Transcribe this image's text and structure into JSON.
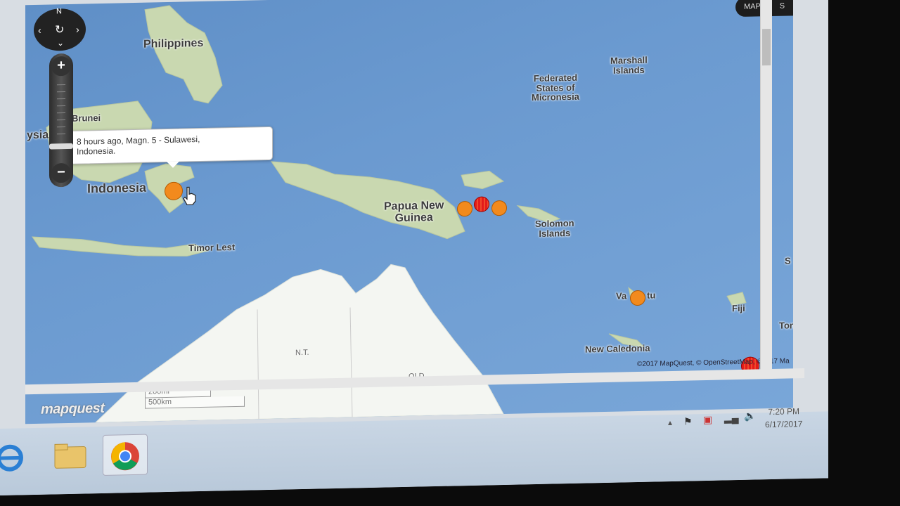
{
  "map": {
    "provider_logo": "mapquest",
    "compass_north": "N",
    "zoom_in": "+",
    "zoom_out": "−",
    "maptype_label": "MAP",
    "maptype_label2": "S",
    "scale_top": "200mi",
    "scale_bottom": "500km",
    "attribution": "©2017 MapQuest, © OpenStreetMap, ©2017 Ma",
    "labels": {
      "philippines": "Philippines",
      "brunei": "Brunei",
      "malaysia_partial": "ysia",
      "indonesia": "Indonesia",
      "timor": "Timor Lest",
      "png_line1": "Papua New",
      "png_line2": "Guinea",
      "micronesia_1": "Federated",
      "micronesia_2": "States of",
      "micronesia_3": "Micronesia",
      "marshall_1": "Marshall",
      "marshall_2": "Islands",
      "solomon_1": "Solomon",
      "solomon_2": "Islands",
      "vanuatu_a": "Va",
      "vanuatu_b": "tu",
      "fiji": "Fiji",
      "tonga": "Tonga",
      "new_caledonia": "New Caledonia",
      "nt": "N.T.",
      "qld": "QLD",
      "edge_s": "S"
    },
    "popup": {
      "line1": "8 hours ago, Magn. 5 - Sulawesi,",
      "line2": "Indonesia."
    },
    "markers": [
      {
        "name": "sulawesi-quake",
        "color": "orange"
      },
      {
        "name": "png-quake-1",
        "color": "orange"
      },
      {
        "name": "png-quake-2",
        "color": "red"
      },
      {
        "name": "png-quake-3",
        "color": "orange"
      },
      {
        "name": "vanuatu-quake",
        "color": "orange"
      },
      {
        "name": "tonga-quake",
        "color": "red"
      }
    ],
    "colors": {
      "ocean": "#6b9ad0",
      "land": "#c9d8b0",
      "australia": "#f4f6f2",
      "orange_marker": "#f28a1d",
      "red_marker": "#e31b1b"
    }
  },
  "taskbar": {
    "time": "7:20 PM",
    "date": "6/17/2017",
    "apps": [
      "internet-explorer-icon",
      "file-explorer-icon",
      "chrome-icon"
    ]
  }
}
